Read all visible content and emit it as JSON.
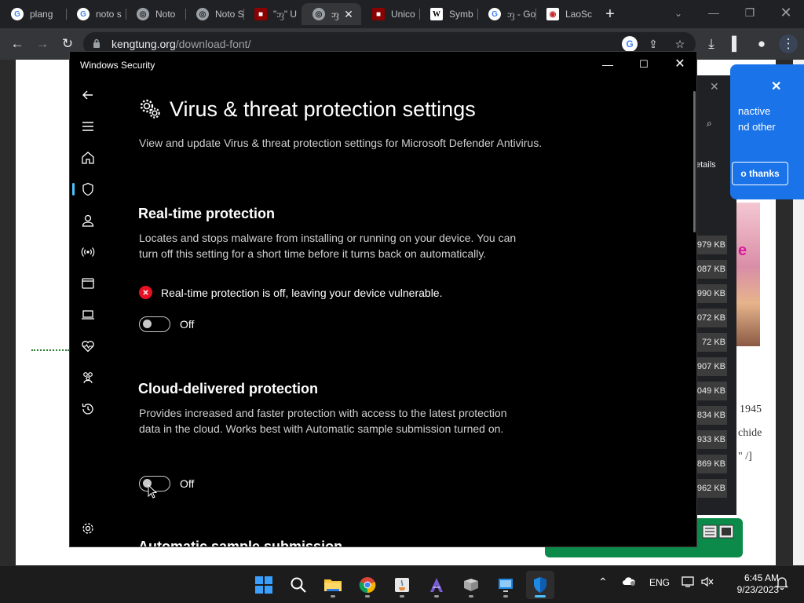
{
  "browser": {
    "tabs": [
      {
        "label": "plang",
        "icon": "google-icon"
      },
      {
        "label": "noto s",
        "icon": "google-icon"
      },
      {
        "label": "Noto",
        "icon": "globe-icon"
      },
      {
        "label": "Noto S",
        "icon": "globe-icon"
      },
      {
        "label": "\"ᦀ\" U",
        "icon": "red-icon"
      },
      {
        "label": "ᦀ",
        "icon": "globe-icon",
        "active": true
      },
      {
        "label": "Unico",
        "icon": "red-icon"
      },
      {
        "label": "Symb",
        "icon": "wikipedia-icon"
      },
      {
        "label": "ᦀ - Go",
        "icon": "google-icon"
      },
      {
        "label": "LaoSc",
        "icon": "laoscript-icon"
      }
    ],
    "url_host": "kengtung.org",
    "url_path": "/download-font/"
  },
  "popup": {
    "text_line1": "nactive",
    "text_line2": "nd other",
    "button": "o thanks"
  },
  "downloads": {
    "details": "etails",
    "sizes": [
      "979 KB",
      "087 KB",
      "990 KB",
      "072 KB",
      "72 KB",
      "907 KB",
      "049 KB",
      "834 KB",
      "933 KB",
      "869 KB",
      "962 KB"
    ]
  },
  "page_bg_text": {
    "line1": "1945",
    "line2": "chide",
    "line3": "\" /]"
  },
  "window": {
    "title": "Windows Security",
    "heading": "Virus & threat protection settings",
    "description": "View and update Virus & threat protection settings for Microsoft Defender Antivirus.",
    "realtime": {
      "title": "Real-time protection",
      "description": "Locates and stops malware from installing or running on your device. You can turn off this setting for a short time before it turns back on automatically.",
      "warning": "Real-time protection is off, leaving your device vulnerable.",
      "toggle_state": "Off"
    },
    "cloud": {
      "title": "Cloud-delivered protection",
      "description": "Provides increased and faster protection with access to the latest protection data in the cloud. Works best with Automatic sample submission turned on.",
      "toggle_state": "Off"
    },
    "next_section_partial": "Automatic sample submission"
  },
  "taskbar": {
    "language": "ENG",
    "time": "6:45 AM",
    "date": "9/23/2023"
  },
  "colors": {
    "accent": "#4cc2ff",
    "error": "#e81123",
    "chrome_blue": "#1a73e8"
  }
}
